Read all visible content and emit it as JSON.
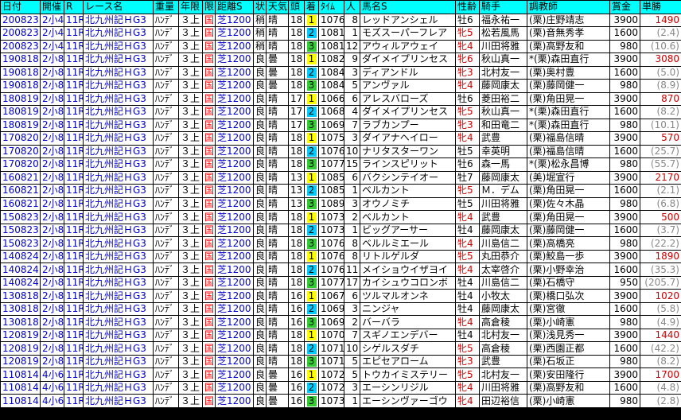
{
  "headers": [
    "日付",
    "開催",
    "R",
    "レース名",
    "重量",
    "年限",
    "限",
    "距離S",
    "状",
    "天気",
    "頭",
    "着",
    "ﾀｲﾑ",
    "人",
    "馬名S",
    "性齢",
    "騎手",
    "調教師",
    "賞金",
    "単勝"
  ],
  "rows": [
    [
      "200823",
      "2小4",
      "11R",
      "北九州記ＨG3",
      "ﾊﾝﾃﾞ",
      "３上",
      "国",
      "芝1200",
      "稍",
      "晴",
      "18",
      "1",
      "1076",
      "8",
      "レッドアンシェル",
      "牡6",
      "福永祐一",
      "(栗)庄野靖志",
      "3900",
      "1490"
    ],
    [
      "200823",
      "2小4",
      "11R",
      "北九州記ＨG3",
      "ﾊﾝﾃﾞ",
      "３上",
      "国",
      "芝1200",
      "稍",
      "晴",
      "18",
      "2",
      "1081",
      "1",
      "モズスーパーフレア",
      "牝5",
      "松若風馬",
      "(栗)音無秀孝",
      "1600",
      "(2.4)"
    ],
    [
      "200823",
      "2小4",
      "11R",
      "北九州記ＨG3",
      "ﾊﾝﾃﾞ",
      "３上",
      "国",
      "芝1200",
      "稍",
      "晴",
      "18",
      "3",
      "1081",
      "12",
      "アウィルアウェイ",
      "牝4",
      "川田将雅",
      "(栗)高野友和",
      "980",
      "(10.6)"
    ],
    [
      "190818",
      "2小8",
      "11R",
      "北九州記ＨG3",
      "ﾊﾝﾃﾞ",
      "３上",
      "国",
      "芝1200",
      "良",
      "曇",
      "18",
      "1",
      "1082",
      "9",
      "ダイメイプリンセス",
      "牝6",
      "秋山真一",
      "*(栗)森田直行",
      "3900",
      "3080"
    ],
    [
      "190818",
      "2小8",
      "11R",
      "北九州記ＨG3",
      "ﾊﾝﾃﾞ",
      "３上",
      "国",
      "芝1200",
      "良",
      "曇",
      "18",
      "2",
      "1084",
      "3",
      "ディアンドル",
      "牝3",
      "北村友一",
      "(栗)奥村豊",
      "1600",
      "(5.0)"
    ],
    [
      "190818",
      "2小8",
      "11R",
      "北九州記ＨG3",
      "ﾊﾝﾃﾞ",
      "３上",
      "国",
      "芝1200",
      "良",
      "曇",
      "18",
      "3",
      "1084",
      "5",
      "アンヴァル",
      "牝4",
      "藤岡康太",
      "(栗)藤岡健一",
      "980",
      "(8.9)"
    ],
    [
      "180819",
      "2小8",
      "11R",
      "北九州記ＨG3",
      "ﾊﾝﾃﾞ",
      "３上",
      "国",
      "芝1200",
      "良",
      "晴",
      "17",
      "1",
      "1066",
      "6",
      "アレスバローズ",
      "牡6",
      "菱田裕二",
      "(栗)角田晃一",
      "3900",
      "870"
    ],
    [
      "180819",
      "2小8",
      "11R",
      "北九州記ＨG3",
      "ﾊﾝﾃﾞ",
      "３上",
      "国",
      "芝1200",
      "良",
      "晴",
      "17",
      "2",
      "1068",
      "4",
      "ダイメイプリンセス",
      "牝5",
      "秋山真一",
      "*(栗)森田直行",
      "1600",
      "(8.2)"
    ],
    [
      "180819",
      "2小8",
      "11R",
      "北九州記ＨG3",
      "ﾊﾝﾃﾞ",
      "３上",
      "国",
      "芝1200",
      "良",
      "晴",
      "17",
      "3",
      "1069",
      "7",
      "ラブカンプー",
      "牝3",
      "和田竜二",
      "*(栗)森田直行",
      "980",
      "(10.1)"
    ],
    [
      "170820",
      "2小8",
      "11R",
      "北九州記ＨG3",
      "ﾊﾝﾃﾞ",
      "３上",
      "国",
      "芝1200",
      "良",
      "晴",
      "18",
      "1",
      "1075",
      "3",
      "ダイアナヘイロー",
      "牝4",
      "武豊",
      "(栗)福島信晴",
      "3900",
      "570"
    ],
    [
      "170820",
      "2小8",
      "11R",
      "北九州記ＨG3",
      "ﾊﾝﾃﾞ",
      "３上",
      "国",
      "芝1200",
      "良",
      "晴",
      "18",
      "2",
      "1076",
      "10",
      "ナリタスターワン",
      "牡5",
      "幸英明",
      "(栗)福島信晴",
      "1600",
      "(25.7)"
    ],
    [
      "170820",
      "2小8",
      "11R",
      "北九州記ＨG3",
      "ﾊﾝﾃﾞ",
      "３上",
      "国",
      "芝1200",
      "良",
      "晴",
      "18",
      "3",
      "1077",
      "15",
      "ラインスピリット",
      "牡6",
      "森一馬",
      "*(栗)松永昌博",
      "980",
      "(55.7)"
    ],
    [
      "160821",
      "2小8",
      "11R",
      "北九州記ＨG3",
      "ﾊﾝﾃﾞ",
      "３上",
      "国",
      "芝1200",
      "良",
      "晴",
      "13",
      "1",
      "1085",
      "6",
      "バクシンテイオー",
      "牡7",
      "藤岡康太",
      "(美)堀宣行",
      "3900",
      "2170"
    ],
    [
      "160821",
      "2小8",
      "11R",
      "北九州記ＨG3",
      "ﾊﾝﾃﾞ",
      "３上",
      "国",
      "芝1200",
      "良",
      "晴",
      "13",
      "2",
      "1085",
      "1",
      "ベルカント",
      "牝5",
      "Ｍ．デム",
      "(栗)角田晃一",
      "1600",
      "(2.1)"
    ],
    [
      "160821",
      "2小8",
      "11R",
      "北九州記ＨG3",
      "ﾊﾝﾃﾞ",
      "３上",
      "国",
      "芝1200",
      "良",
      "晴",
      "13",
      "3",
      "1089",
      "3",
      "オウノミチ",
      "牡5",
      "川田将雅",
      "(栗)佐々木晶",
      "980",
      "(6.8)"
    ],
    [
      "150823",
      "2小8",
      "11R",
      "北九州記ＨG3",
      "ﾊﾝﾃﾞ",
      "３上",
      "国",
      "芝1200",
      "良",
      "晴",
      "18",
      "1",
      "1073",
      "2",
      "ベルカント",
      "牝4",
      "武豊",
      "(栗)角田晃一",
      "3900",
      "500"
    ],
    [
      "150823",
      "2小8",
      "11R",
      "北九州記ＨG3",
      "ﾊﾝﾃﾞ",
      "３上",
      "国",
      "芝1200",
      "良",
      "晴",
      "18",
      "2",
      "1073",
      "1",
      "ビッグアーサー",
      "牡4",
      "藤岡康太",
      "(栗)藤岡健一",
      "1600",
      "(3.7)"
    ],
    [
      "150823",
      "2小8",
      "11R",
      "北九州記ＨG3",
      "ﾊﾝﾃﾞ",
      "３上",
      "国",
      "芝1200",
      "良",
      "晴",
      "18",
      "3",
      "1076",
      "8",
      "ベルルミエール",
      "牝4",
      "川島信二",
      "(栗)高橋亮",
      "980",
      "(22.2)"
    ],
    [
      "140824",
      "2小8",
      "11R",
      "北九州記ＨG3",
      "ﾊﾝﾃﾞ",
      "３上",
      "国",
      "芝1200",
      "良",
      "晴",
      "18",
      "1",
      "1076",
      "8",
      "リトルゲルダ",
      "牝5",
      "丸田恭介",
      "(栗)鮫島一歩",
      "3900",
      "1890"
    ],
    [
      "140824",
      "2小8",
      "11R",
      "北九州記ＨG3",
      "ﾊﾝﾃﾞ",
      "３上",
      "国",
      "芝1200",
      "良",
      "晴",
      "18",
      "2",
      "1076",
      "11",
      "メイショウイザヨイ",
      "牝4",
      "太宰啓介",
      "(栗)小野幸治",
      "1600",
      "(35.3)"
    ],
    [
      "140824",
      "2小8",
      "11R",
      "北九州記ＨG3",
      "ﾊﾝﾃﾞ",
      "３上",
      "国",
      "芝1200",
      "良",
      "晴",
      "18",
      "3",
      "1077",
      "17",
      "カイシュウコロンボ",
      "牡4",
      "川島信二",
      "(栗)石橋守",
      "950",
      "(205.7)"
    ],
    [
      "130818",
      "2小8",
      "11R",
      "北九州記ＨG3",
      "ﾊﾝﾃﾞ",
      "３上",
      "国",
      "芝1200",
      "良",
      "晴",
      "16",
      "1",
      "1067",
      "6",
      "ツルマルオンネ",
      "牡4",
      "小牧太",
      "(栗)橋口弘次",
      "3900",
      "1020"
    ],
    [
      "130818",
      "2小8",
      "11R",
      "北九州記ＨG3",
      "ﾊﾝﾃﾞ",
      "３上",
      "国",
      "芝1200",
      "良",
      "晴",
      "16",
      "2",
      "1069",
      "3",
      "ニンジャ",
      "牡4",
      "藤岡康太",
      "(栗)宮徹",
      "1600",
      "(5.8)"
    ],
    [
      "130818",
      "2小8",
      "11R",
      "北九州記ＨG3",
      "ﾊﾝﾃﾞ",
      "３上",
      "国",
      "芝1200",
      "良",
      "晴",
      "16",
      "3",
      "1069",
      "2",
      "バーバラ",
      "牝4",
      "高倉稜",
      "(栗)小崎憲",
      "980",
      "(4.9)"
    ],
    [
      "120819",
      "2小8",
      "11R",
      "北九州記ＨG3",
      "ﾊﾝﾃﾞ",
      "３上",
      "国",
      "芝1200",
      "良",
      "晴",
      "18",
      "1",
      "1070",
      "7",
      "スギノエンデバー",
      "牡4",
      "北村友一",
      "(栗)浅見秀一",
      "3900",
      "1440"
    ],
    [
      "120819",
      "2小8",
      "11R",
      "北九州記ＨG3",
      "ﾊﾝﾃﾞ",
      "３上",
      "国",
      "芝1200",
      "良",
      "晴",
      "18",
      "2",
      "1071",
      "10",
      "シゲルスダチ",
      "牝5",
      "高倉稜",
      "(栗)西園正都",
      "1600",
      "(42.2)"
    ],
    [
      "120819",
      "2小8",
      "11R",
      "北九州記ＨG3",
      "ﾊﾝﾃﾞ",
      "３上",
      "国",
      "芝1200",
      "良",
      "晴",
      "18",
      "3",
      "1071",
      "5",
      "エピセアローム",
      "牝3",
      "武豊",
      "(栗)石坂正",
      "980",
      "(8.2)"
    ],
    [
      "110814",
      "4小6",
      "11R",
      "北九州記ＨG3",
      "ﾊﾝﾃﾞ",
      "３上",
      "国",
      "芝1200",
      "良",
      "曇",
      "16",
      "1",
      "1072",
      "5",
      "トウカイミステリー",
      "牝5",
      "北村友一",
      "(栗)安田隆行",
      "3900",
      "1700"
    ],
    [
      "110814",
      "4小6",
      "11R",
      "北九州記ＨG3",
      "ﾊﾝﾃﾞ",
      "３上",
      "国",
      "芝1200",
      "良",
      "曇",
      "16",
      "2",
      "1072",
      "3",
      "エーシンリジル",
      "牝4",
      "川田将雅",
      "(栗)高野友和",
      "1600",
      "(4.8)"
    ],
    [
      "110814",
      "4小6",
      "11R",
      "北九州記ＨG3",
      "ﾊﾝﾃﾞ",
      "３上",
      "国",
      "芝1200",
      "良",
      "曇",
      "16",
      "3",
      "1073",
      "1",
      "エーシンヴァーゴウ",
      "牝4",
      "田辺裕信",
      "(栗)小崎憲",
      "980",
      "(2.8)"
    ]
  ],
  "colors": {
    "header_bg": "#00ffff",
    "win": "#ffff00",
    "second": "#00ccff",
    "third": "#33cc33",
    "mare": "#cc0000",
    "payout": "#cc0000",
    "pop": "#888888"
  }
}
